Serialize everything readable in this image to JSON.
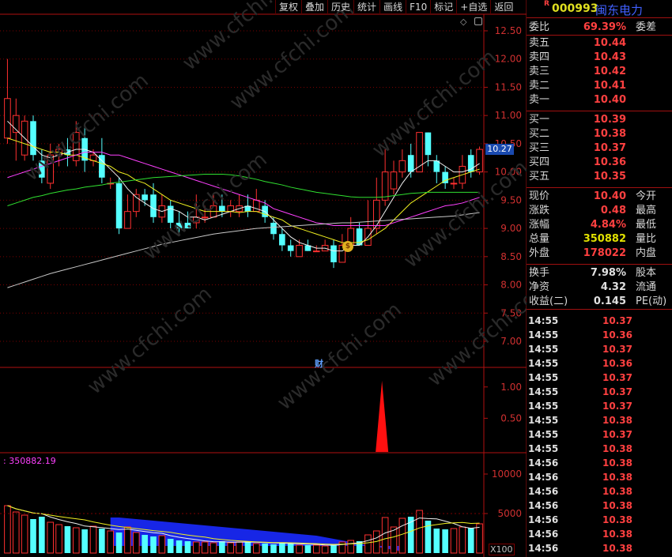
{
  "toolbar": [
    "复权",
    "叠加",
    "历史",
    "统计",
    "画线",
    "F10",
    "标记",
    "+自选",
    "返回"
  ],
  "stock": {
    "r_mark": "R",
    "code": "000993",
    "name": "闽东电力"
  },
  "current_price_tag": "10.27",
  "fin_marker": "财",
  "volume_label": "350882.19",
  "vol_unit": "X100",
  "quote": {
    "weibi_label": "委比",
    "weibi_value": "69.39%",
    "weicha_label": "委差",
    "asks": [
      {
        "label": "卖五",
        "price": "10.44"
      },
      {
        "label": "卖四",
        "price": "10.43"
      },
      {
        "label": "卖三",
        "price": "10.42"
      },
      {
        "label": "卖二",
        "price": "10.41"
      },
      {
        "label": "卖一",
        "price": "10.40"
      }
    ],
    "bids": [
      {
        "label": "买一",
        "price": "10.39"
      },
      {
        "label": "买二",
        "price": "10.38"
      },
      {
        "label": "买三",
        "price": "10.37"
      },
      {
        "label": "买四",
        "price": "10.36"
      },
      {
        "label": "买五",
        "price": "10.35"
      }
    ],
    "stats": [
      {
        "label": "现价",
        "value": "10.40",
        "label2": "今开",
        "color": "#ff4040"
      },
      {
        "label": "涨跌",
        "value": "0.48",
        "label2": "最高",
        "color": "#ff4040"
      },
      {
        "label": "涨幅",
        "value": "4.84%",
        "label2": "最低",
        "color": "#ff4040"
      },
      {
        "label": "总量",
        "value": "350882",
        "label2": "量比",
        "color": "#e0e000"
      },
      {
        "label": "外盘",
        "value": "178022",
        "label2": "内盘",
        "color": "#ff4040"
      }
    ],
    "stats2": [
      {
        "label": "换手",
        "value": "7.98%",
        "label2": "股本"
      },
      {
        "label": "净资",
        "value": "4.32",
        "label2": "流通"
      },
      {
        "label": "收益(二)",
        "value": "0.145",
        "label2": "PE(动)"
      }
    ]
  },
  "ticks": [
    {
      "time": "14:55",
      "price": "10.37"
    },
    {
      "time": "14:55",
      "price": "10.36"
    },
    {
      "time": "14:55",
      "price": "10.37"
    },
    {
      "time": "14:55",
      "price": "10.36"
    },
    {
      "time": "14:55",
      "price": "10.37"
    },
    {
      "time": "14:55",
      "price": "10.37"
    },
    {
      "time": "14:55",
      "price": "10.37"
    },
    {
      "time": "14:55",
      "price": "10.38"
    },
    {
      "time": "14:55",
      "price": "10.37"
    },
    {
      "time": "14:55",
      "price": "10.38"
    },
    {
      "time": "14:56",
      "price": "10.38"
    },
    {
      "time": "14:56",
      "price": "10.38"
    },
    {
      "time": "14:56",
      "price": "10.38"
    },
    {
      "time": "14:56",
      "price": "10.38"
    },
    {
      "time": "14:56",
      "price": "10.38"
    },
    {
      "time": "14:56",
      "price": "10.38"
    },
    {
      "time": "14:56",
      "price": "10.38"
    }
  ],
  "colors": {
    "up": "#ff3030",
    "down": "#54ffff",
    "grid": "#7a0000",
    "axis": "#b01010"
  },
  "chart_data": [
    {
      "type": "candlestick",
      "ylim": [
        6.75,
        12.7
      ],
      "y_ticks": [
        12.5,
        12.0,
        11.5,
        11.0,
        10.5,
        10.0,
        9.5,
        9.0,
        8.5,
        8.0,
        7.5,
        7.0
      ],
      "y_tick_labels": [
        "12.50",
        "12.00",
        "11.50",
        "11.00",
        "10.50",
        "10.00",
        "9.50",
        "9.00",
        "8.50",
        "8.00",
        "7.50",
        "7.00"
      ],
      "candles": [
        [
          10.6,
          11.3,
          12.0,
          10.5
        ],
        [
          10.7,
          11.0,
          11.3,
          10.2
        ],
        [
          10.3,
          10.9,
          11.0,
          10.2
        ],
        [
          10.9,
          10.3,
          11.0,
          10.2
        ],
        [
          10.2,
          9.9,
          10.4,
          9.8
        ],
        [
          9.8,
          10.3,
          10.5,
          9.7
        ],
        [
          10.3,
          10.4,
          10.5,
          10.1
        ],
        [
          10.4,
          10.3,
          10.6,
          10.1
        ],
        [
          10.2,
          10.7,
          10.9,
          10.1
        ],
        [
          10.6,
          10.2,
          10.8,
          10.0
        ],
        [
          10.2,
          10.3,
          10.4,
          10.1
        ],
        [
          10.3,
          9.9,
          10.6,
          9.8
        ],
        [
          9.8,
          9.8,
          9.9,
          9.7
        ],
        [
          9.8,
          9.0,
          9.9,
          8.9
        ],
        [
          9.0,
          9.3,
          9.6,
          9.0
        ],
        [
          9.3,
          9.6,
          9.7,
          9.2
        ],
        [
          9.6,
          9.5,
          9.7,
          9.4
        ],
        [
          9.6,
          9.2,
          9.8,
          9.1
        ],
        [
          9.2,
          9.4,
          9.6,
          9.1
        ],
        [
          9.4,
          9.1,
          9.5,
          9.0
        ],
        [
          9.1,
          9.0,
          9.3,
          8.9
        ],
        [
          9.1,
          9.0,
          9.3,
          9.0
        ],
        [
          9.1,
          9.2,
          9.6,
          9.0
        ],
        [
          9.2,
          9.2,
          9.4,
          9.1
        ],
        [
          9.2,
          9.4,
          9.6,
          9.2
        ],
        [
          9.4,
          9.3,
          9.6,
          9.2
        ],
        [
          9.3,
          9.4,
          9.5,
          9.2
        ],
        [
          9.3,
          9.4,
          9.6,
          9.2
        ],
        [
          9.4,
          9.3,
          9.6,
          9.2
        ],
        [
          9.3,
          9.5,
          9.7,
          9.3
        ],
        [
          9.4,
          9.2,
          9.5,
          9.1
        ],
        [
          9.1,
          8.9,
          9.2,
          8.8
        ],
        [
          8.9,
          8.7,
          9.0,
          8.6
        ],
        [
          8.7,
          8.6,
          8.8,
          8.5
        ],
        [
          8.5,
          8.7,
          8.8,
          8.5
        ],
        [
          8.7,
          8.6,
          8.8,
          8.6
        ],
        [
          8.6,
          8.6,
          8.7,
          8.6
        ],
        [
          8.6,
          8.7,
          8.8,
          8.6
        ],
        [
          8.7,
          8.4,
          8.8,
          8.3
        ],
        [
          8.4,
          8.7,
          8.9,
          8.4
        ],
        [
          8.7,
          9.0,
          9.2,
          8.7
        ],
        [
          9.0,
          8.7,
          9.1,
          8.7
        ],
        [
          8.7,
          9.0,
          9.5,
          8.7
        ],
        [
          9.0,
          9.5,
          9.9,
          8.9
        ],
        [
          9.5,
          10.0,
          10.4,
          9.4
        ],
        [
          9.7,
          10.0,
          10.2,
          9.6
        ],
        [
          10.0,
          10.2,
          10.4,
          9.9
        ],
        [
          10.3,
          10.0,
          10.5,
          9.9
        ],
        [
          10.0,
          10.7,
          10.7,
          10.0
        ],
        [
          10.7,
          10.3,
          10.7,
          10.1
        ],
        [
          10.2,
          10.0,
          10.3,
          9.8
        ],
        [
          10.0,
          9.8,
          10.1,
          9.7
        ],
        [
          9.8,
          9.8,
          9.9,
          9.7
        ],
        [
          9.8,
          10.1,
          10.3,
          9.7
        ],
        [
          10.3,
          10.0,
          10.4,
          9.9
        ],
        [
          10.0,
          10.4,
          10.45,
          9.95
        ]
      ],
      "ma5": [
        10.9,
        10.75,
        10.6,
        10.45,
        10.3,
        10.25,
        10.3,
        10.35,
        10.4,
        10.4,
        10.35,
        10.2,
        10.05,
        9.9,
        9.7,
        9.55,
        9.45,
        9.35,
        9.3,
        9.35,
        9.3,
        9.2,
        9.2,
        9.15,
        9.2,
        9.25,
        9.3,
        9.35,
        9.4,
        9.35,
        9.3,
        9.15,
        9.0,
        8.85,
        8.75,
        8.7,
        8.65,
        8.65,
        8.6,
        8.6,
        8.7,
        8.7,
        8.85,
        9.05,
        9.3,
        9.55,
        9.8,
        10.0,
        10.1,
        10.2,
        10.2,
        10.1,
        10.0,
        10.0,
        10.05,
        10.15
      ],
      "ma10": [
        10.6,
        10.55,
        10.5,
        10.45,
        10.4,
        10.35,
        10.35,
        10.3,
        10.3,
        10.25,
        10.2,
        10.15,
        10.1,
        10.0,
        9.95,
        9.85,
        9.8,
        9.7,
        9.6,
        9.5,
        9.45,
        9.4,
        9.35,
        9.3,
        9.3,
        9.3,
        9.3,
        9.28,
        9.3,
        9.3,
        9.25,
        9.2,
        9.15,
        9.05,
        9.0,
        8.95,
        8.9,
        8.85,
        8.8,
        8.75,
        8.75,
        8.75,
        8.8,
        8.9,
        9.0,
        9.15,
        9.3,
        9.45,
        9.55,
        9.65,
        9.75,
        9.85,
        9.9,
        9.95,
        10.0,
        10.05
      ],
      "ma20": [
        9.9,
        9.95,
        10.0,
        10.05,
        10.1,
        10.15,
        10.2,
        10.25,
        10.3,
        10.35,
        10.35,
        10.35,
        10.3,
        10.3,
        10.25,
        10.2,
        10.15,
        10.1,
        10.05,
        10.0,
        9.95,
        9.9,
        9.85,
        9.8,
        9.75,
        9.7,
        9.65,
        9.6,
        9.55,
        9.5,
        9.45,
        9.35,
        9.3,
        9.25,
        9.2,
        9.15,
        9.1,
        9.08,
        9.05,
        9.05,
        9.05,
        9.05,
        9.05,
        9.05,
        9.05,
        9.1,
        9.15,
        9.2,
        9.25,
        9.3,
        9.35,
        9.4,
        9.42,
        9.45,
        9.5,
        9.55
      ],
      "ma60": [
        9.4,
        9.45,
        9.5,
        9.55,
        9.58,
        9.62,
        9.65,
        9.68,
        9.7,
        9.73,
        9.75,
        9.77,
        9.8,
        9.82,
        9.84,
        9.86,
        9.88,
        9.9,
        9.91,
        9.92,
        9.93,
        9.94,
        9.95,
        9.96,
        9.96,
        9.96,
        9.95,
        9.93,
        9.9,
        9.87,
        9.83,
        9.8,
        9.77,
        9.73,
        9.7,
        9.67,
        9.64,
        9.62,
        9.6,
        9.58,
        9.56,
        9.55,
        9.55,
        9.55,
        9.56,
        9.58,
        9.6,
        9.62,
        9.63,
        9.64,
        9.64,
        9.64,
        9.64,
        9.64,
        9.64,
        9.64
      ],
      "ma120": [
        7.95,
        8.0,
        8.05,
        8.1,
        8.15,
        8.2,
        8.24,
        8.28,
        8.32,
        8.36,
        8.4,
        8.44,
        8.48,
        8.52,
        8.56,
        8.6,
        8.64,
        8.68,
        8.72,
        8.75,
        8.78,
        8.81,
        8.84,
        8.87,
        8.9,
        8.92,
        8.94,
        8.96,
        8.98,
        9.0,
        9.01,
        9.02,
        9.03,
        9.04,
        9.05,
        9.06,
        9.07,
        9.08,
        9.09,
        9.1,
        9.1,
        9.11,
        9.12,
        9.13,
        9.14,
        9.15,
        9.16,
        9.17,
        9.18,
        9.19,
        9.2,
        9.21,
        9.22,
        9.24,
        9.26,
        9.28
      ],
      "lines": [
        {
          "key": "ma5",
          "color": "#f0f0f0"
        },
        {
          "key": "ma10",
          "color": "#f0f020"
        },
        {
          "key": "ma20",
          "color": "#ff40ff"
        },
        {
          "key": "ma60",
          "color": "#30e030"
        },
        {
          "key": "ma120",
          "color": "#c8c8c8"
        }
      ]
    },
    {
      "type": "area",
      "ylim": [
        0,
        1.3
      ],
      "y_ticks": [
        1.0,
        0.5
      ],
      "y_tick_labels": [
        "1.00",
        "0.50"
      ],
      "spike": {
        "index": 44,
        "value": 1.1
      }
    },
    {
      "type": "bar",
      "ylim": [
        0,
        12200
      ],
      "y_ticks": [
        10000,
        5000
      ],
      "y_tick_labels": [
        "10000",
        "5000"
      ],
      "values": [
        6000,
        5200,
        4800,
        4300,
        4600,
        3900,
        3600,
        3400,
        3200,
        3000,
        3400,
        3100,
        2800,
        2600,
        3300,
        2600,
        2300,
        2100,
        2200,
        1800,
        1600,
        1500,
        1400,
        1400,
        1300,
        1500,
        1300,
        1400,
        1500,
        1200,
        1200,
        1100,
        1300,
        1200,
        1000,
        1000,
        1000,
        900,
        1100,
        1400,
        1600,
        1500,
        2300,
        2800,
        4500,
        3300,
        4400,
        4600,
        5400,
        4100,
        3100,
        3000,
        3100,
        3300,
        3200,
        3700
      ],
      "blue_area": [
        5500,
        5500,
        5400,
        5300,
        5200,
        5100,
        5000,
        4900,
        4800,
        4700,
        4600,
        4500,
        4400,
        4300,
        4200,
        4100,
        4000,
        3900,
        3800,
        3700,
        3600,
        3500,
        3400,
        3300,
        3200,
        3000,
        2800,
        2600,
        2400,
        2200,
        2000,
        1800,
        1600,
        1400,
        1200
      ]
    }
  ]
}
